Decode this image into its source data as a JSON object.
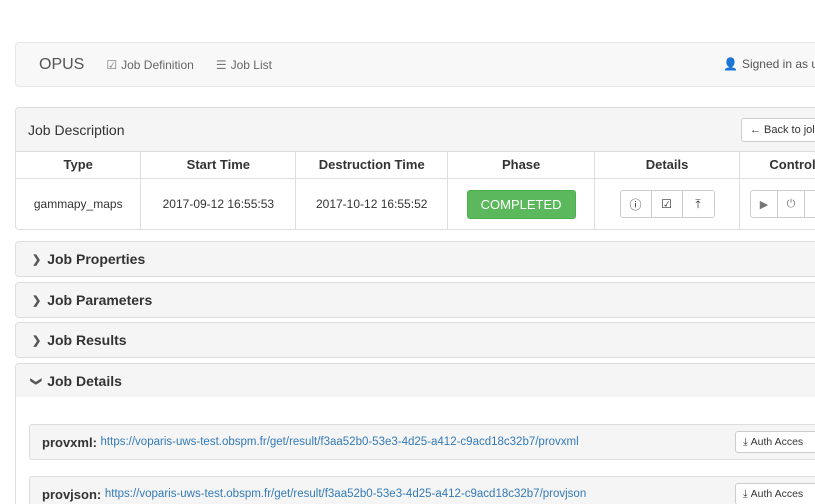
{
  "navbar": {
    "brand": "OPUS",
    "links": [
      {
        "icon": "edit-icon",
        "glyph": "☑",
        "label": "Job Definition"
      },
      {
        "icon": "list-icon",
        "glyph": "☰",
        "label": "Job List"
      }
    ],
    "signed_in": "Signed in as u"
  },
  "job_description": {
    "title": "Job Description",
    "back_button": "Back to jol",
    "columns": [
      "Type",
      "Start Time",
      "Destruction Time",
      "Phase",
      "Details",
      "Control"
    ],
    "row": {
      "type": "gammapy_maps",
      "start_time": "2017-09-12 16:55:53",
      "destruction_time": "2017-10-12 16:55:52",
      "phase": "COMPLETED"
    }
  },
  "sections": [
    {
      "label": "Job Properties",
      "state": "collapsed"
    },
    {
      "label": "Job Parameters",
      "state": "collapsed"
    },
    {
      "label": "Job Results",
      "state": "collapsed"
    },
    {
      "label": "Job Details",
      "state": "expanded"
    }
  ],
  "results": [
    {
      "name": "provxml",
      "url": "https://voparis-uws-test.obspm.fr/get/result/f3aa52b0-53e3-4d25-a412-c9acd18c32b7/provxml",
      "button": "Auth Acces"
    },
    {
      "name": "provjson",
      "url": "https://voparis-uws-test.obspm.fr/get/result/f3aa52b0-53e3-4d25-a412-c9acd18c32b7/provjson",
      "button": "Auth Acces"
    }
  ],
  "colors": {
    "success": "#5cb85c",
    "link": "#337ab7",
    "panel_bg": "#f5f5f5"
  }
}
